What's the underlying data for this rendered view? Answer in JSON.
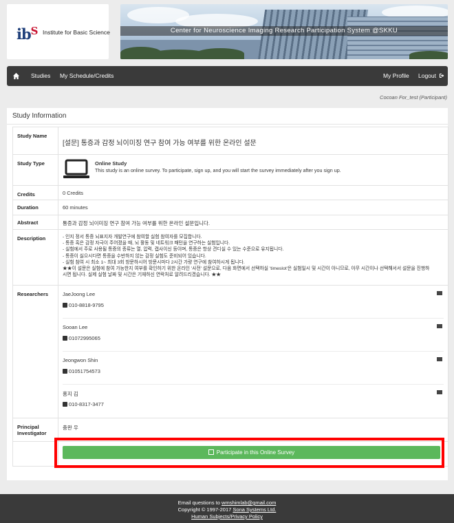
{
  "header": {
    "logo_mark": "ibs",
    "logo_text": "Institute for Basic Science",
    "banner_title": "Center for Neuroscience Imaging Research Participation System @SKKU"
  },
  "navbar": {
    "items": [
      "Studies",
      "My Schedule/Credits"
    ],
    "right": [
      "My Profile",
      "Logout"
    ]
  },
  "user_line": "Cocoan For_test (Participant)",
  "panel": {
    "heading": "Study Information",
    "labels": {
      "name": "Study Name",
      "type": "Study Type",
      "credits": "Credits",
      "duration": "Duration",
      "abstract": "Abstract",
      "description": "Description",
      "researchers": "Researchers",
      "pi": "Principal Investigator"
    },
    "study_name": "[설문] 통증과 감정 뇌이미징 연구 참여 가능 여부를 위한 온라인 설문",
    "study_type_title": "Online Study",
    "study_type_desc": "This study is an online survey. To participate, sign up, and you will start the survey immediately after you sign up.",
    "credits": "0 Credits",
    "duration": "60 minutes",
    "abstract": "통증과 감정 뇌이미징 연구 참여 가능 여부를 위한 온라인 설문입니다.",
    "description": [
      "- 인지 정서 통증 뇌표지자 개발연구에 참여할 실험 참여자를 모집합니다.",
      "- 통증 혹은 감정 자극이 주어졌을 때, 뇌 활동 및 네트워크 패턴을 연구하는 실험입니다.",
      "- 실험에서 주로 사용될 통증의 종류는 열, 압력, 캡사이신 등이며, 통증은 항상 견디실 수 있는 수준으로 유지됩니다.",
      "- 통증이 싫으시다면 통증을 수반하지 않는 감정 실험도 준비되어 있습니다.",
      "- 실험 참여 시 최소 1~ 최대 3회 방문하시어 방문시마다 2시간 가량 연구에 참여하시게 됩니다.",
      "★★이 설문은 실험에 참여 가능한지 여부를 확인하기 위한 온라인 '사전' 설문으로, 다음 화면에서 선택하실 'timeslot'은 실험일시 및 시간이 아니므로, 아무 시간이나 선택해서서 설문을 진행하",
      "시면 됩니다. 실제 실험 날짜 및 시간은 기재하신 연락처로 알려드리겠습니다. ★★"
    ],
    "researchers": [
      {
        "name": "JaeJoong Lee",
        "phone": "010-8818-9795"
      },
      {
        "name": "Sooan Lee",
        "phone": "01072995065"
      },
      {
        "name": "Jeongwon Shin",
        "phone": "01051754573"
      },
      {
        "name": "홍지 김",
        "phone": "010-8317-3477"
      }
    ],
    "pi": "충완 우",
    "participate_label": "Participate in this Online Survey"
  },
  "footer": {
    "email_prefix": "Email questions to ",
    "email": "wmshimlab@gmail.com",
    "copyright_prefix": "Copyright © 1997-2017 ",
    "company": "Sona Systems Ltd.",
    "policy": "Human Subjects/Privacy Policy"
  },
  "colors": {
    "navbar": "#3a3a3a",
    "button_green": "#5cb85c",
    "highlight_red": "#ff0000"
  }
}
